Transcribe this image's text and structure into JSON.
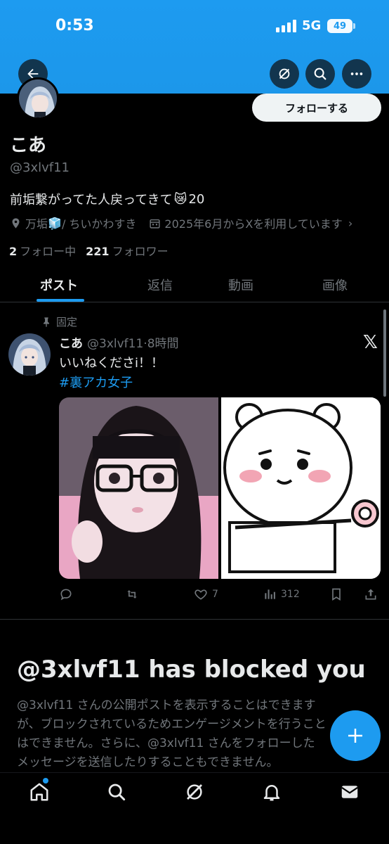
{
  "status_bar": {
    "time": "0:53",
    "network": "5G",
    "battery": "49"
  },
  "header": {
    "back_icon": "arrow-left-icon",
    "grok_icon": "grok-icon",
    "search_icon": "search-icon",
    "more_icon": "more-icon",
    "banner_color": "#1d9bf0"
  },
  "profile": {
    "display_name": "こあ",
    "handle": "@3xlvf11",
    "follow_label": "フォローする",
    "bio": "前垢繋がってた人戻ってきて",
    "bio_emoji": "😿",
    "bio_number": "20",
    "location": "万垢",
    "location_emoji": "🧊",
    "location_rest": " / ちいかわすき",
    "joined": "2025年6月からXを利用しています",
    "following_count": "2",
    "following_label": "フォロー中",
    "followers_count": "221",
    "followers_label": "フォロワー"
  },
  "tabs": [
    {
      "label": "ポスト",
      "active": true
    },
    {
      "label": "返信",
      "active": false
    },
    {
      "label": "動画",
      "active": false
    },
    {
      "label": "画像",
      "active": false
    }
  ],
  "post": {
    "pinned_label": "固定",
    "author_name": "こあ",
    "author_handle": "@3xlvf11",
    "time": "8時間",
    "x_logo": "𝕏",
    "text": "いいねくださi！！",
    "hashtag": "#裏アカ女子",
    "likes": "7",
    "views": "312"
  },
  "blocked": {
    "title": "@3xlvf11 has blocked you",
    "line1": "@3xlvf11 さんの公開ポストを表示することはできます",
    "line2": "が、ブロックされているためエンゲージメントを行うこと",
    "line3": "はできません。さらに、@3xlvf11 さんをフォローした",
    "line4": "メッセージを送信したりすることもできません。"
  },
  "bottom_nav": [
    "home-icon",
    "search-icon",
    "grok-icon",
    "notifications-icon",
    "messages-icon"
  ],
  "colors": {
    "accent": "#1d9bf0",
    "background": "#000000",
    "secondary_text": "#71767b"
  }
}
